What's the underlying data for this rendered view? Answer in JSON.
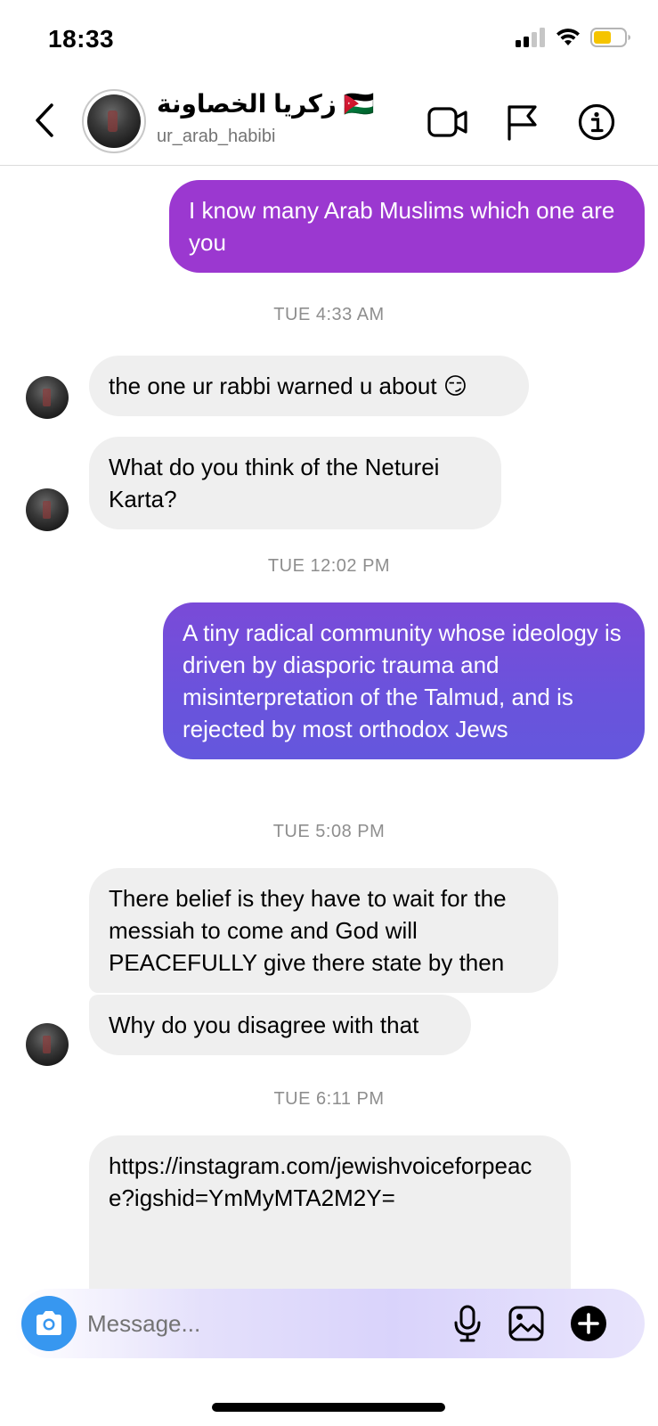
{
  "status_bar": {
    "time": "18:33",
    "icons": [
      "signal-icon",
      "wifi-icon",
      "battery-icon"
    ],
    "battery_color": "#f5c400"
  },
  "header": {
    "display_name": "زكريا الخصاونة 🇯🇴",
    "handle": "ur_arab_habibi",
    "icons": [
      "back-chevron-icon",
      "video-call-icon",
      "flag-icon",
      "info-icon"
    ]
  },
  "messages": [
    {
      "sender": "me",
      "text": "I know many Arab Muslims which one are you"
    },
    {
      "type": "timestamp",
      "text": "TUE 4:33 AM"
    },
    {
      "sender": "them",
      "text": "the one ur rabbi warned u about 😏"
    },
    {
      "sender": "them",
      "text": "What do you think of the Neturei Karta?"
    },
    {
      "type": "timestamp",
      "text": "TUE 12:02 PM"
    },
    {
      "sender": "me",
      "text": "A tiny radical community whose ideology is driven by diasporic trauma and misinterpretation of the Talmud, and is rejected by most orthodox Jews"
    },
    {
      "type": "timestamp",
      "text": "TUE 5:08 PM"
    },
    {
      "sender": "them",
      "text": "There belief is they have to wait for the messiah to come and God will PEACEFULLY give there state by then"
    },
    {
      "sender": "them",
      "text": "Why do you disagree with that"
    },
    {
      "type": "timestamp",
      "text": "TUE 6:11 PM"
    },
    {
      "sender": "them",
      "type": "link",
      "text": "https://instagram.com/jewishvoiceforpeace?igshid=YmMyMTA2M2Y="
    }
  ],
  "composer": {
    "placeholder": "Message...",
    "value": "",
    "icons": [
      "camera-icon",
      "microphone-icon",
      "gallery-icon",
      "plus-circle-icon"
    ]
  },
  "colors": {
    "bubble_mine_purple": "#9b38d0",
    "bubble_mine_indigo": "#6a53dc",
    "bubble_theirs": "#efefef",
    "link": "#00376b",
    "camera_blue": "#3797f0"
  }
}
